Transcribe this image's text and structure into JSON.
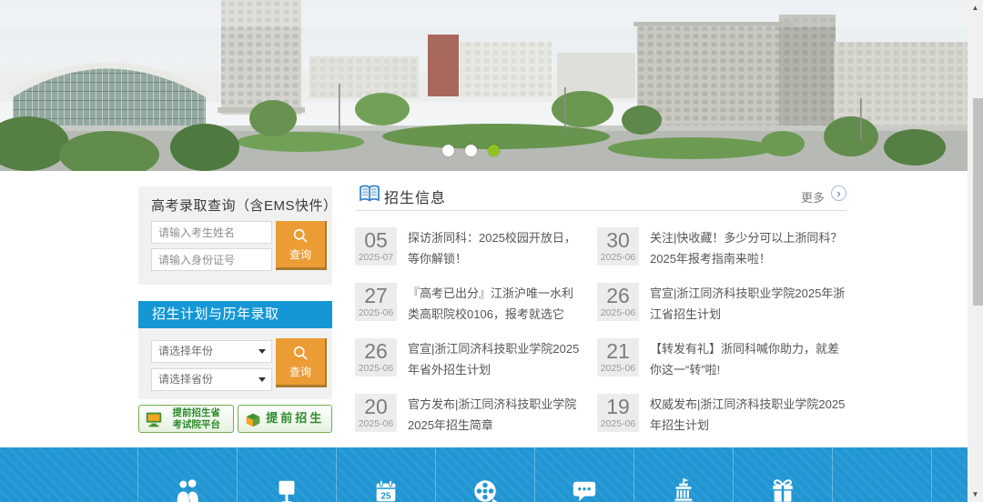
{
  "banner": {
    "dots": [
      "inactive",
      "inactive",
      "active"
    ]
  },
  "lookup": {
    "title": "高考录取查询（含EMS快件）",
    "name_placeholder": "请输入考生姓名",
    "id_placeholder": "请输入身份证号",
    "search_label": "查询"
  },
  "plan": {
    "title": "招生计划与历年录取",
    "year_placeholder": "请选择年份",
    "province_placeholder": "请选择省份",
    "search_label": "查询"
  },
  "badges": [
    {
      "line1": "提前招生省",
      "line2": "考试院平台"
    },
    {
      "line1": "提前招生",
      "line2": ""
    }
  ],
  "news": {
    "title": "招生信息",
    "more_label": "更多",
    "items": [
      {
        "day": "05",
        "date": "2025-07",
        "title": "探访浙同科：2025校园开放日，等你解锁！"
      },
      {
        "day": "30",
        "date": "2025-06",
        "title": "关注|快收藏！多少分可以上浙同科？2025年报考指南来啦！"
      },
      {
        "day": "27",
        "date": "2025-06",
        "title": "『高考已出分』江浙沪唯一水利类高职院校0106，报考就选它"
      },
      {
        "day": "26",
        "date": "2025-06",
        "title": "官宣|浙江同济科技职业学院2025年浙江省招生计划"
      },
      {
        "day": "26",
        "date": "2025-06",
        "title": "官宣|浙江同济科技职业学院2025年省外招生计划"
      },
      {
        "day": "21",
        "date": "2025-06",
        "title": "【转发有礼】浙同科喊你助力，就差你这一“转”啦!"
      },
      {
        "day": "20",
        "date": "2025-06",
        "title": "官方发布|浙江同济科技职业学院2025年招生简章"
      },
      {
        "day": "19",
        "date": "2025-06",
        "title": "权威发布|浙江同济科技职业学院2025年招生计划"
      }
    ]
  },
  "footer": {
    "calendar_day": "25",
    "cells": [
      {
        "icon": "people-icon"
      },
      {
        "icon": "signboard-icon"
      },
      {
        "icon": "calendar-icon"
      },
      {
        "icon": "film-reel-icon"
      },
      {
        "icon": "message-icon"
      },
      {
        "icon": "government-building-icon"
      },
      {
        "icon": "gift-icon"
      },
      {
        "icon": ""
      }
    ]
  },
  "colors": {
    "accent_blue": "#1597d5",
    "accent_orange": "#ec9c35",
    "footer_blue": "#2196d3",
    "badge_green": "#2e8b2e",
    "active_dot_green": "#8fc320"
  }
}
